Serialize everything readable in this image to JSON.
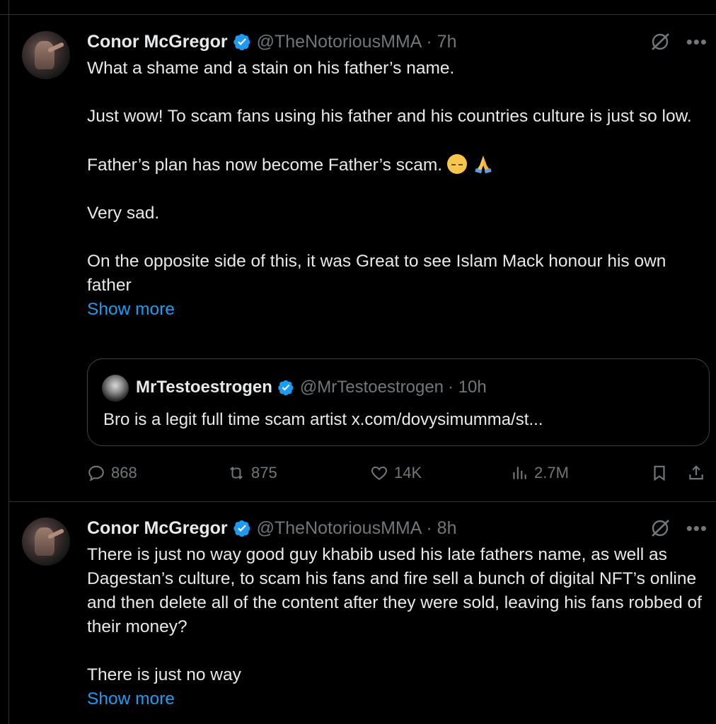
{
  "tweets": [
    {
      "author": {
        "name": "Conor McGregor",
        "handle": "@TheNotoriousMMA",
        "time": "· 7h"
      },
      "lines": [
        "What a shame and a stain on his father’s name.",
        "",
        "Just wow! To scam fans using his father and his countries culture is just so low.",
        "",
        "Father’s plan has now become Father’s scam.",
        "",
        "Very sad.",
        "",
        "On the opposite side of this, it was Great to see Islam Mack honour his own father"
      ],
      "show_more": "Show more",
      "quote": {
        "name": "MrTestoestrogen",
        "handle": "@MrTestoestrogen",
        "time": "· 10h",
        "text": "Bro is a legit full time scam artist x.com/dovysimumma/st..."
      },
      "stats": {
        "replies": "868",
        "reposts": "875",
        "likes": "14K",
        "views": "2.7M"
      }
    },
    {
      "author": {
        "name": "Conor McGregor",
        "handle": "@TheNotoriousMMA",
        "time": "· 8h"
      },
      "lines": [
        "There is just no way good guy khabib used his late fathers name, as well as Dagestan’s culture, to scam his fans and fire sell a bunch of digital NFT’s online and then delete all of the content after they were sold, leaving his fans robbed of their money?",
        "",
        "There is just no way"
      ],
      "show_more": "Show more"
    }
  ],
  "icons": {
    "verified": "verified-badge-icon",
    "grok": "grok-icon",
    "more": "more-icon",
    "reply": "reply-icon",
    "repost": "repost-icon",
    "like": "heart-icon",
    "views": "views-icon",
    "bookmark": "bookmark-icon",
    "share": "share-icon",
    "emoji1": "pensive-face-icon",
    "emoji2": "folded-hands-icon"
  },
  "colors": {
    "background": "#000000",
    "text": "#e7e9ea",
    "secondary": "#71767b",
    "link": "#1d9bf0",
    "verified": "#1d9bf0",
    "border": "#2f3336"
  }
}
